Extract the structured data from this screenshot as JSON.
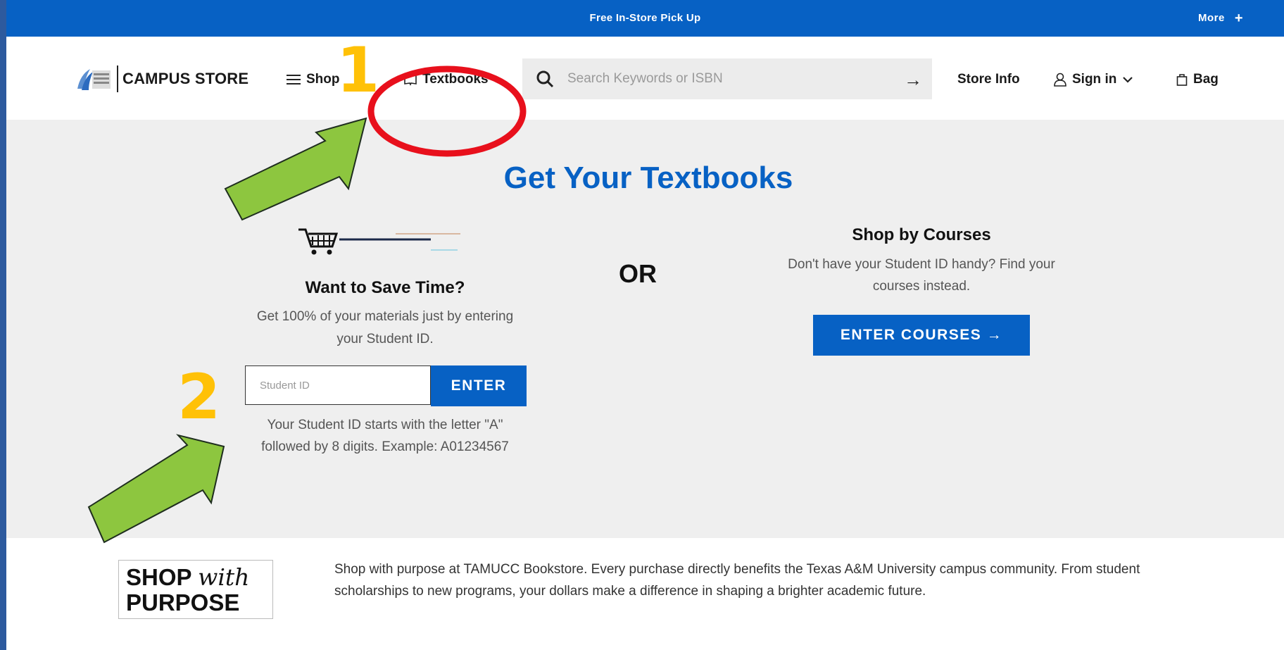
{
  "topbar": {
    "promo": "Free In-Store Pick Up",
    "more_label": "More",
    "more_icon": "plus-icon"
  },
  "header": {
    "logo_text": "CAMPUS STORE",
    "shop_label": "Shop",
    "textbooks_label": "Textbooks",
    "search_placeholder": "Search Keywords or ISBN",
    "store_info_label": "Store Info",
    "signin_label": "Sign in",
    "bag_label": "Bag"
  },
  "main": {
    "title": "Get Your Textbooks",
    "want_title": "Want to Save Time?",
    "want_desc": "Get 100% of your materials just by entering your Student ID.",
    "student_id_placeholder": "Student ID",
    "enter_label": "ENTER",
    "hint": "Your Student ID starts with the letter \"A\" followed by 8 digits. Example: A01234567",
    "or_label": "OR",
    "courses_title": "Shop by Courses",
    "courses_desc": "Don't have your Student ID handy? Find your courses instead.",
    "enter_courses_label": "ENTER COURSES →"
  },
  "footer": {
    "badge_line1_a": "SHOP",
    "badge_line1_b": "with",
    "badge_line2": "PURPOSE",
    "text": "Shop with purpose at TAMUCC Bookstore. Every purchase directly benefits the Texas A&M University campus community. From student scholarships to new programs, your dollars make a difference in shaping a brighter academic future."
  },
  "annotations": {
    "step1": "1",
    "step2": "2",
    "arrow_color": "#8dc63f",
    "circle_color": "#e8101c",
    "number_color": "#ffc107"
  },
  "colors": {
    "brand_blue": "#0761c4",
    "page_bg": "#efefef"
  }
}
